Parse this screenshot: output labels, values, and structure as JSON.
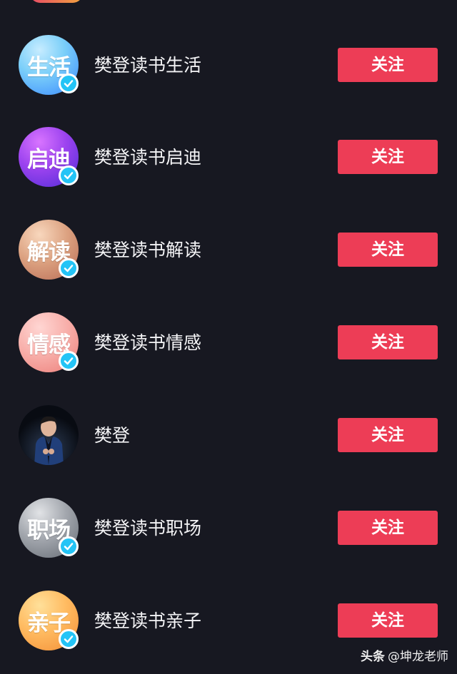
{
  "accounts": [
    {
      "name": "樊登读书生活",
      "avatar_text": "生活",
      "button_label": "关注",
      "avatar_colors": [
        "#8ad8ff",
        "#3b8dff"
      ],
      "verified": true
    },
    {
      "name": "樊登读书启迪",
      "avatar_text": "启迪",
      "button_label": "关注",
      "avatar_colors": [
        "#c259ff",
        "#5a2dde"
      ],
      "verified": true
    },
    {
      "name": "樊登读书解读",
      "avatar_text": "解读",
      "button_label": "关注",
      "avatar_colors": [
        "#f0c4a4",
        "#c27658"
      ],
      "verified": true
    },
    {
      "name": "樊登读书情感",
      "avatar_text": "情感",
      "button_label": "关注",
      "avatar_colors": [
        "#ffc0bd",
        "#f08c86"
      ],
      "verified": true
    },
    {
      "name": "樊登",
      "avatar_text": "",
      "button_label": "关注",
      "avatar_colors": [
        "#090c13",
        "#2c3648"
      ],
      "verified": false
    },
    {
      "name": "樊登读书职场",
      "avatar_text": "职场",
      "button_label": "关注",
      "avatar_colors": [
        "#c5c7cc",
        "#6d727b"
      ],
      "verified": true
    },
    {
      "name": "樊登读书亲子",
      "avatar_text": "亲子",
      "button_label": "关注",
      "avatar_colors": [
        "#ffca74",
        "#f59a3f"
      ],
      "verified": true
    }
  ],
  "watermark": {
    "brand": "头条",
    "handle": "@坤龙老师"
  },
  "icons": {
    "verified": "verified-check-icon",
    "person": "presenter-photo-icon"
  },
  "colors": {
    "background": "#171821",
    "button": "#ed3d56",
    "verified_badge": "#24c4f6"
  }
}
